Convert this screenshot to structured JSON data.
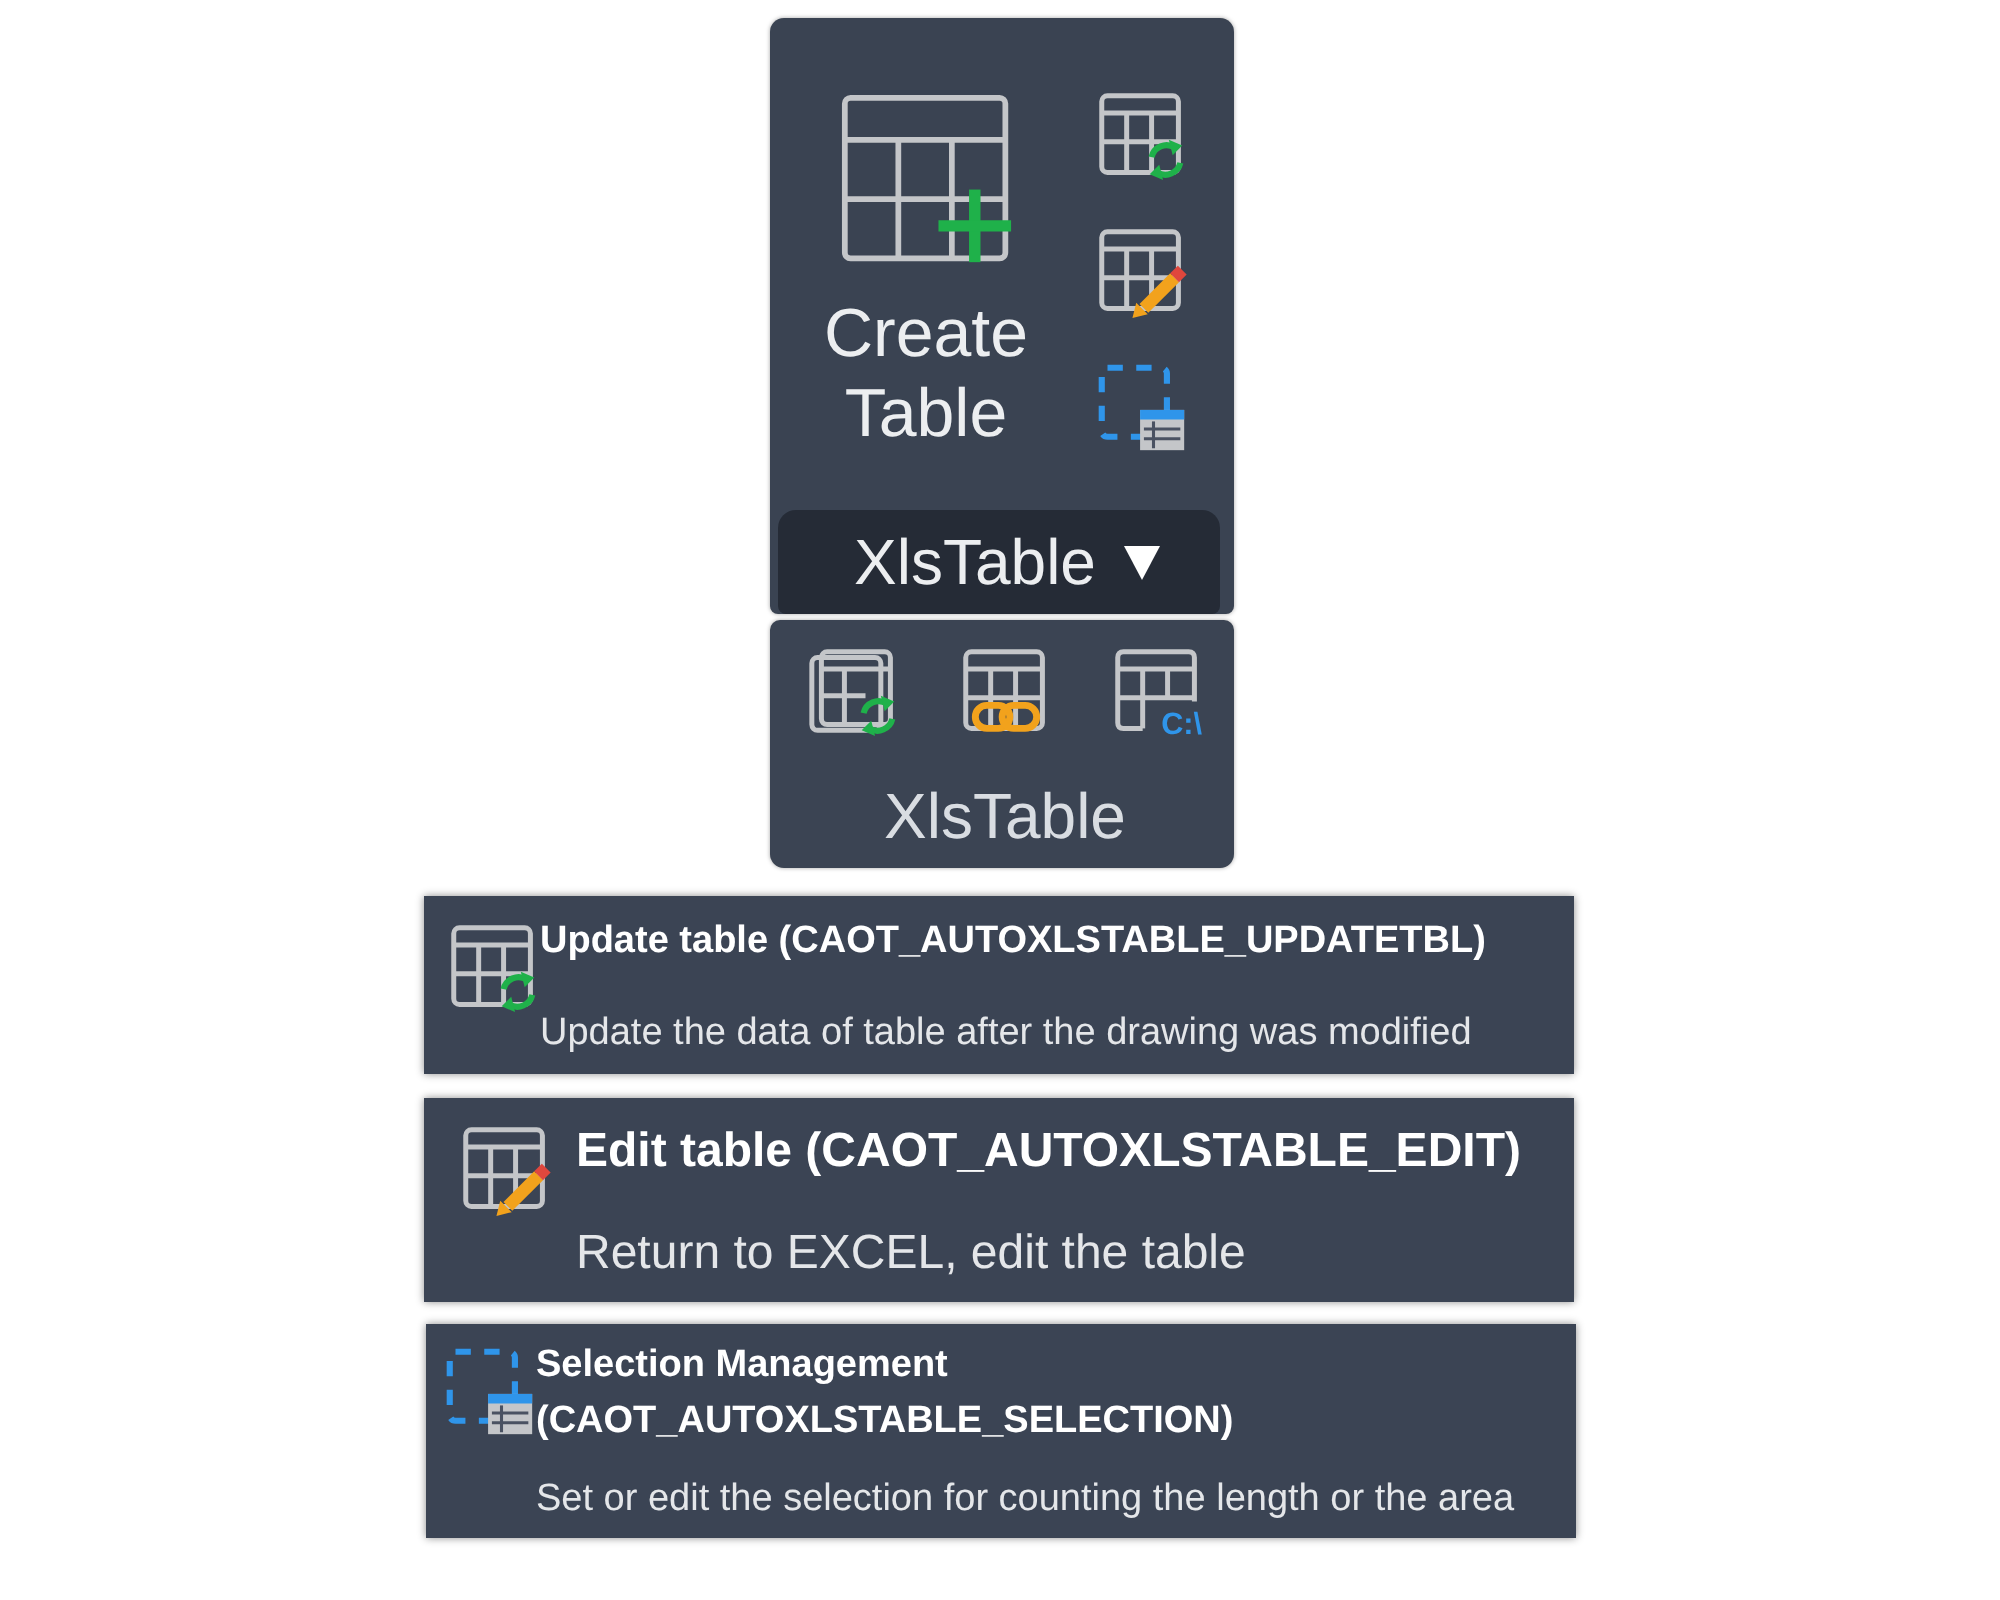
{
  "ribbon_panel": {
    "large_button": {
      "label": "Create Table"
    },
    "small_buttons": [
      {
        "kind": "update"
      },
      {
        "kind": "edit"
      },
      {
        "kind": "selection"
      }
    ],
    "title": "XlsTable",
    "expanded": true
  },
  "expanded_panel": {
    "buttons": [
      {
        "kind": "update-all"
      },
      {
        "kind": "link"
      },
      {
        "kind": "path",
        "icon_text": "C:\\"
      }
    ],
    "label": "XlsTable"
  },
  "tooltips": [
    {
      "kind": "update",
      "title": "Update table (CAOT_AUTOXLSTABLE_UPDATETBL)",
      "description": "Update the data of table after the drawing was modified"
    },
    {
      "kind": "edit",
      "title": "Edit table (CAOT_AUTOXLSTABLE_EDIT)",
      "description": "Return to EXCEL, edit the table"
    },
    {
      "kind": "selection",
      "title": "Selection Management (CAOT_AUTOXLSTABLE_SELECTION)",
      "description": "Set or edit the selection for counting the length or the area"
    }
  ]
}
